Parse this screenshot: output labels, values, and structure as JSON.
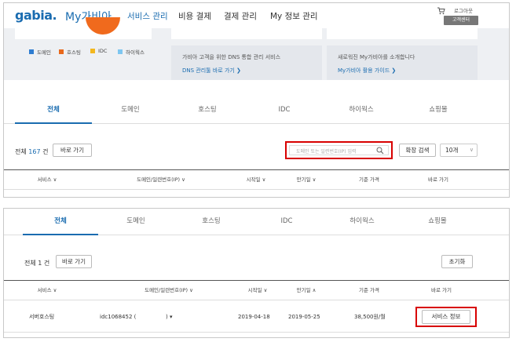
{
  "header": {
    "logo": "gabia.",
    "logo_sub": "My가비아",
    "nav": [
      "서비스 관리",
      "비용 결제",
      "결제 관리",
      "My 정보 관리"
    ],
    "logout": "로그아웃",
    "center": "고객센터"
  },
  "legend": [
    {
      "label": "도메인",
      "color": "#2f7dd1"
    },
    {
      "label": "호스팅",
      "color": "#e8691c"
    },
    {
      "label": "IDC",
      "color": "#f3b71e"
    },
    {
      "label": "하이웍스",
      "color": "#7ec6f0"
    }
  ],
  "info": {
    "box1_text": "가비아 고객을 위한 DNS 통합 관리 서비스",
    "box1_link": "DNS 관리툴 바로 가기 ❯",
    "box2_text": "새로워진 My가비아를 소개합니다",
    "box2_link": "My가비아 활용 가이드 ❯"
  },
  "tabs": [
    "전체",
    "도메인",
    "호스팅",
    "IDC",
    "하이웍스",
    "쇼핑몰"
  ],
  "top": {
    "count_prefix": "전체 ",
    "count_num": "167",
    "count_suffix": " 건",
    "goto": "바로 가기",
    "search_placeholder": "도메인 또는 일련번호(IP) 입력",
    "ext_search": "확장 검색",
    "page_size": "10개",
    "columns": [
      "서비스 ∨",
      "도메인/일련번호(IP) ∨",
      "시작일 ∨",
      "만기일 ∨",
      "기준 가격",
      "바로 가기"
    ]
  },
  "bottom": {
    "count": "전체 1 건",
    "goto": "바로 가기",
    "reset": "초기화",
    "columns": [
      "서비스 ∨",
      "도메인/일련번호(IP) ∨",
      "시작일 ∨",
      "만기일 ∧",
      "기준 가격",
      "바로 가기"
    ],
    "row": {
      "service": "서버호스팅",
      "domain": "idc1068452 (",
      "domain_tail": ") ▾",
      "start": "2019-04-18",
      "end": "2019-05-25",
      "price": "38,500원/월",
      "action": "서비스 정보"
    }
  },
  "colors": {
    "accent": "#1a6cb0",
    "highlight": "#d80000"
  }
}
